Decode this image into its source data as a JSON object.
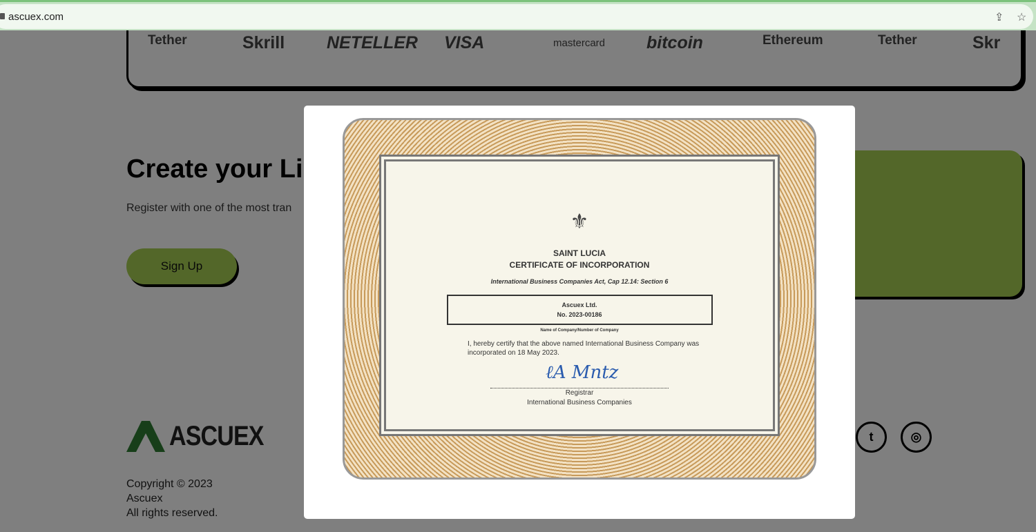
{
  "browser": {
    "url": "ascuex.com"
  },
  "payments": [
    "Tether",
    "Skrill",
    "NETELLER",
    "VISA",
    "mastercard",
    "bitcoin",
    "Ethereum",
    "Tether",
    "Skr"
  ],
  "hero": {
    "title": "Create your Li",
    "subtitle": "Register with one of the most tran",
    "signup": "Sign Up"
  },
  "footer": {
    "brand": "ASCUEX",
    "copyright": "Copyright © 2023",
    "company": "Ascuex",
    "rights": "All rights reserved."
  },
  "certificate": {
    "country": "SAINT LUCIA",
    "title": "CERTIFICATE OF INCORPORATION",
    "act": "International Business Companies Act, Cap 12.14: Section 6",
    "company": "Ascuex Ltd.",
    "number": "No. 2023-00186",
    "caption": "Name of Company/Number of Company",
    "statement": "I, hereby certify that the above named International Business Company was incorporated on 18 May 2023.",
    "signer": "Registrar",
    "signer_org": "International Business Companies"
  },
  "colors": {
    "accent": "#a6cf52"
  }
}
